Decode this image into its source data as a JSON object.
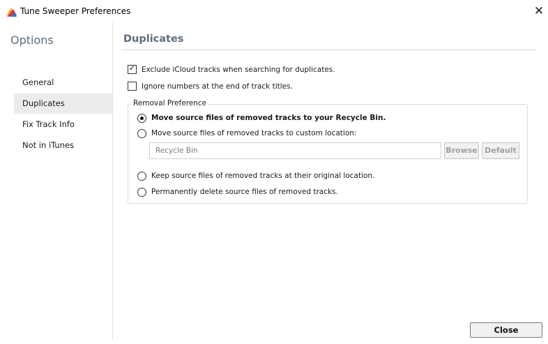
{
  "window": {
    "title": "Tune Sweeper Preferences",
    "close_glyph": "✕",
    "app_icon": "tune-sweeper-logo"
  },
  "sidebar": {
    "heading": "Options",
    "items": [
      {
        "label": "General",
        "selected": false
      },
      {
        "label": "Duplicates",
        "selected": true
      },
      {
        "label": "Fix Track Info",
        "selected": false
      },
      {
        "label": "Not in iTunes",
        "selected": false
      }
    ]
  },
  "main": {
    "title": "Duplicates",
    "checkboxes": [
      {
        "label": "Exclude iCloud tracks when searching for duplicates.",
        "checked": true
      },
      {
        "label": "Ignore numbers at the end of track titles.",
        "checked": false
      }
    ],
    "removal": {
      "legend": "Removal Preference",
      "options": [
        {
          "label": "Move source files of removed tracks to your Recycle Bin.",
          "selected": true
        },
        {
          "label": "Move source files of removed tracks to custom location:",
          "selected": false
        },
        {
          "label": "Keep source files of removed tracks at their original location.",
          "selected": false
        },
        {
          "label": "Permanently delete source files of removed tracks.",
          "selected": false
        }
      ],
      "custom_location": {
        "value": "Recycle Bin",
        "browse_label": "Browse",
        "default_label": "Default"
      }
    }
  },
  "footer": {
    "close_label": "Close"
  },
  "colors": {
    "heading": "#5f6e7e",
    "selected_bg": "#ececec",
    "logo_red": "#d8324a",
    "logo_blue": "#3a78c4",
    "logo_yellow": "#f2b526"
  }
}
